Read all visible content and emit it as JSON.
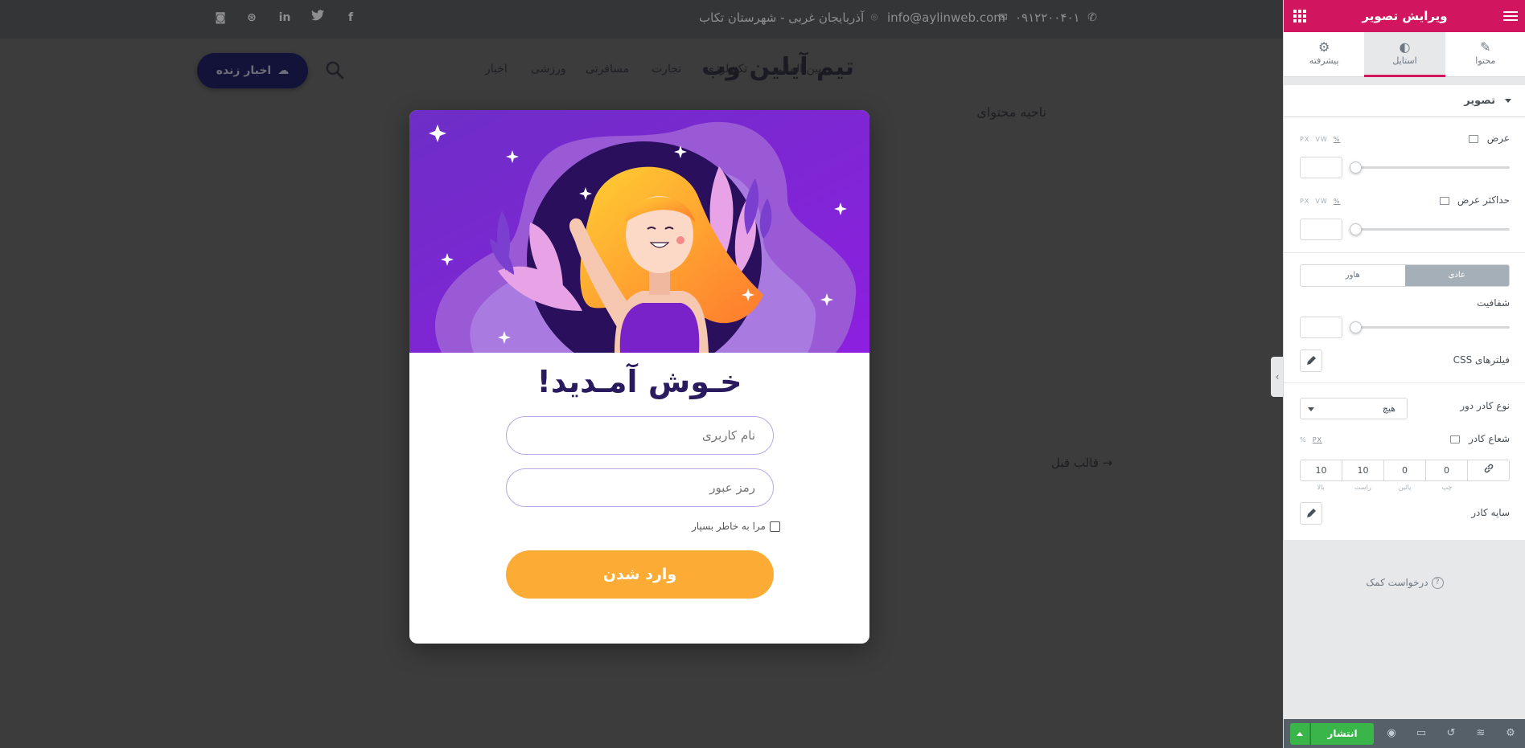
{
  "site": {
    "phone": "۰۹۱۲۲۰۰۴۰۱",
    "email": "info@aylinweb.com",
    "address": "آذربایجان غربی - شهرستان تکاب",
    "social_icons": [
      "instagram-icon",
      "dribbble-icon",
      "linkedin-icon",
      "twitter-icon",
      "facebook-icon"
    ],
    "logo": "تیم آیلین وب",
    "nav": [
      "بین المللی",
      "تکنولوژی",
      "تجارت",
      "مسافرتی",
      "ورزشی",
      "اخبار"
    ],
    "live_button": "اخبار زنده",
    "content_area_text": "ناحیه محتوای",
    "prev_link": "→ قالب قبل"
  },
  "popup": {
    "title": "خـوش آمـدید!",
    "username_placeholder": "نام کاربری",
    "password_placeholder": "رمز عبور",
    "remember_label": "مرا به خاطر بسپار",
    "login_button": "وارد شدن",
    "colors": {
      "illustration_bg": "#8a2be2",
      "button": "#fcab34",
      "title": "#2a1a5e"
    }
  },
  "panel": {
    "title": "ویرایش تصویر",
    "tabs": [
      {
        "label": "محتوا",
        "icon": "pencil-icon",
        "active": false
      },
      {
        "label": "استایل",
        "icon": "contrast-icon",
        "active": true
      },
      {
        "label": "پیشرفته",
        "icon": "gear-icon",
        "active": false
      }
    ],
    "section": "تصویر",
    "width_label": "عرض",
    "max_width_label": "حداکثر عرض",
    "units": [
      "PX",
      "VW",
      "%"
    ],
    "state_normal": "عادی",
    "state_hover": "هاور",
    "opacity_label": "شفافیت",
    "css_filters_label": "فیلترهای CSS",
    "border_type_label": "نوع کادر دور",
    "border_type_value": "هیچ",
    "border_radius_label": "شعاع کادر",
    "radius_units": [
      "PX",
      "%"
    ],
    "radius_values": {
      "top": "10",
      "right": "10",
      "bottom": "0",
      "left": "0"
    },
    "radius_labels": {
      "top": "بالا",
      "right": "راست",
      "bottom": "پائین",
      "left": "چپ"
    },
    "box_shadow_label": "سایه کادر",
    "help": "درخواست کمک",
    "publish": "انتشار",
    "accent": "#d1155e"
  }
}
